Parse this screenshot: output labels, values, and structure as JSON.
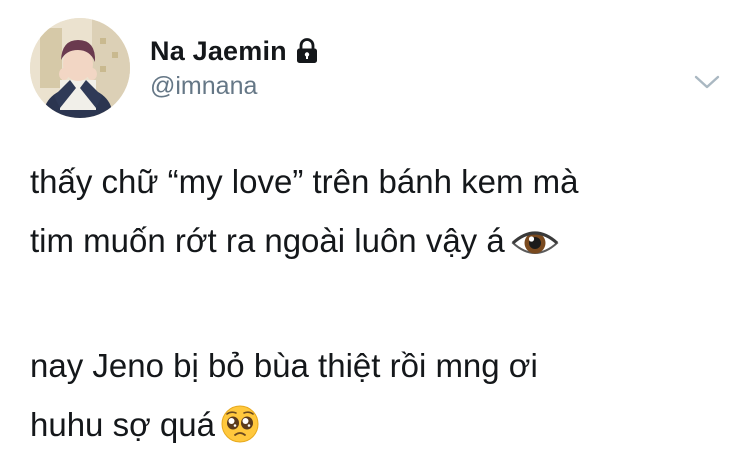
{
  "author": {
    "display_name": "Na Jaemin",
    "handle": "@imnana",
    "protected": true
  },
  "icons": {
    "lock": "lock-icon",
    "chevron": "chevron-down-icon",
    "eye_emoji": "eye-emoji-icon",
    "pleading_emoji": "pleading-face-emoji-icon"
  },
  "tweet": {
    "line1": "thấy chữ “my love” trên bánh kem mà",
    "line2": "tim muốn rớt ra ngoài luôn vậy á",
    "line3": "nay Jeno bị bỏ bùa thiệt rồi mng ơi",
    "line4": "huhu sợ quá"
  },
  "colors": {
    "text": "#14171a",
    "secondary": "#657786",
    "chevron": "#aab8c2"
  }
}
